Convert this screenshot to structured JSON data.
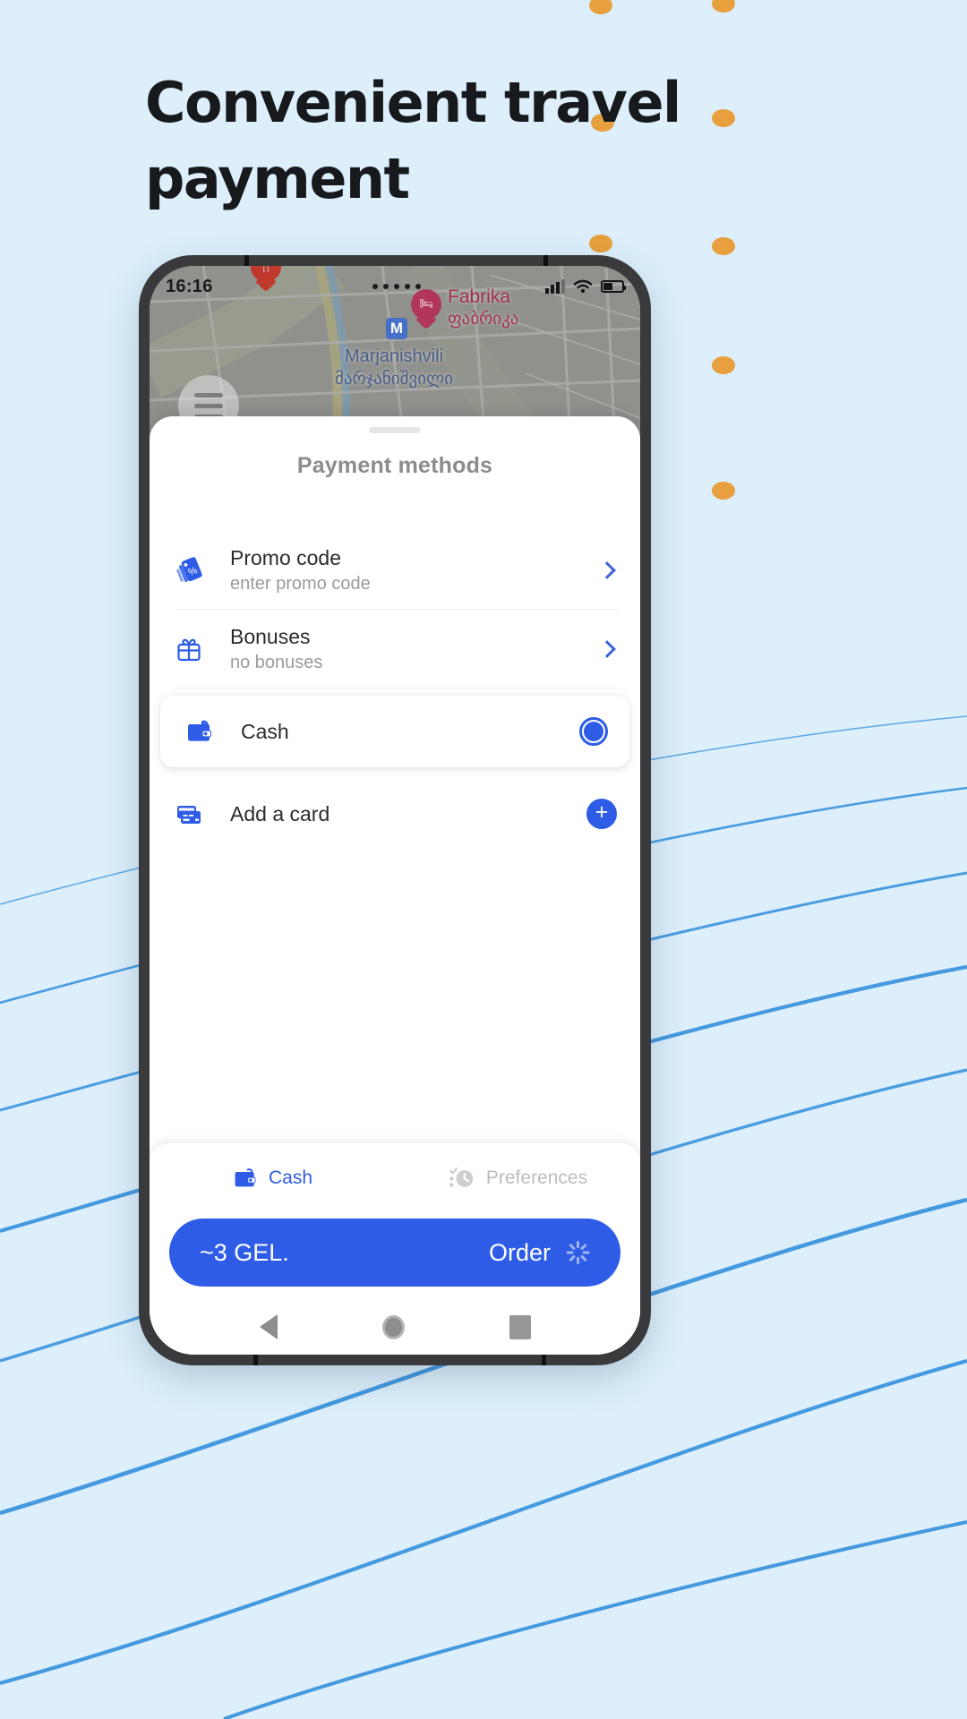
{
  "promo": {
    "headline": "Convenient travel payment",
    "background_color": "#dceffb",
    "accent_dot_color": "#e8a03e",
    "line_color": "#3b94dd"
  },
  "phone": {
    "statusbar": {
      "time": "16:16",
      "signal_icon": "signal-bars-icon",
      "wifi_icon": "wifi-icon",
      "battery_icon": "battery-icon",
      "battery_level": "52%"
    },
    "map": {
      "menu_icon": "hamburger-menu-icon",
      "metro_badge": "M",
      "labels": [
        {
          "name_latin": "Marjanishvili",
          "name_georgian": "მარჯანიშვილი"
        }
      ],
      "pois": [
        {
          "name_latin": "Fabrika",
          "name_georgian": "ფაბრიკა",
          "icon": "hotel-bed-icon",
          "color": "#b0365a"
        },
        {
          "name_latin": "",
          "name_georgian": "",
          "icon": "restaurant-icon",
          "color": "#c0392b"
        }
      ]
    },
    "sheet": {
      "title": "Payment methods",
      "grabber": "drag-handle",
      "items": [
        {
          "id": "promo-code",
          "icon": "promo-tag-percent-icon",
          "title": "Promo code",
          "subtitle": "enter promo code",
          "trailing": "chevron-right-icon"
        },
        {
          "id": "bonuses",
          "icon": "gift-icon",
          "title": "Bonuses",
          "subtitle": "no bonuses",
          "trailing": "chevron-right-icon"
        },
        {
          "id": "cash",
          "icon": "wallet-icon",
          "title": "Cash",
          "subtitle": "",
          "trailing": "radio-selected-icon",
          "selected": true
        },
        {
          "id": "add-a-card",
          "icon": "credit-cards-icon",
          "title": "Add a card",
          "subtitle": "",
          "trailing": "plus-button-icon"
        }
      ]
    },
    "bottom_bar": {
      "options": [
        {
          "id": "cash",
          "label": "Cash",
          "icon": "wallet-icon",
          "active": true
        },
        {
          "id": "preferences",
          "label": "Preferences",
          "icon": "checklist-clock-icon",
          "active": false
        }
      ],
      "order_button": {
        "price": "~3 GEL.",
        "label": "Order",
        "spinner": "loading-spinner-icon",
        "color": "#2e5ce6"
      }
    },
    "navbar": {
      "back": "back-triangle-icon",
      "home": "home-circle-icon",
      "recents": "recents-square-icon"
    }
  }
}
